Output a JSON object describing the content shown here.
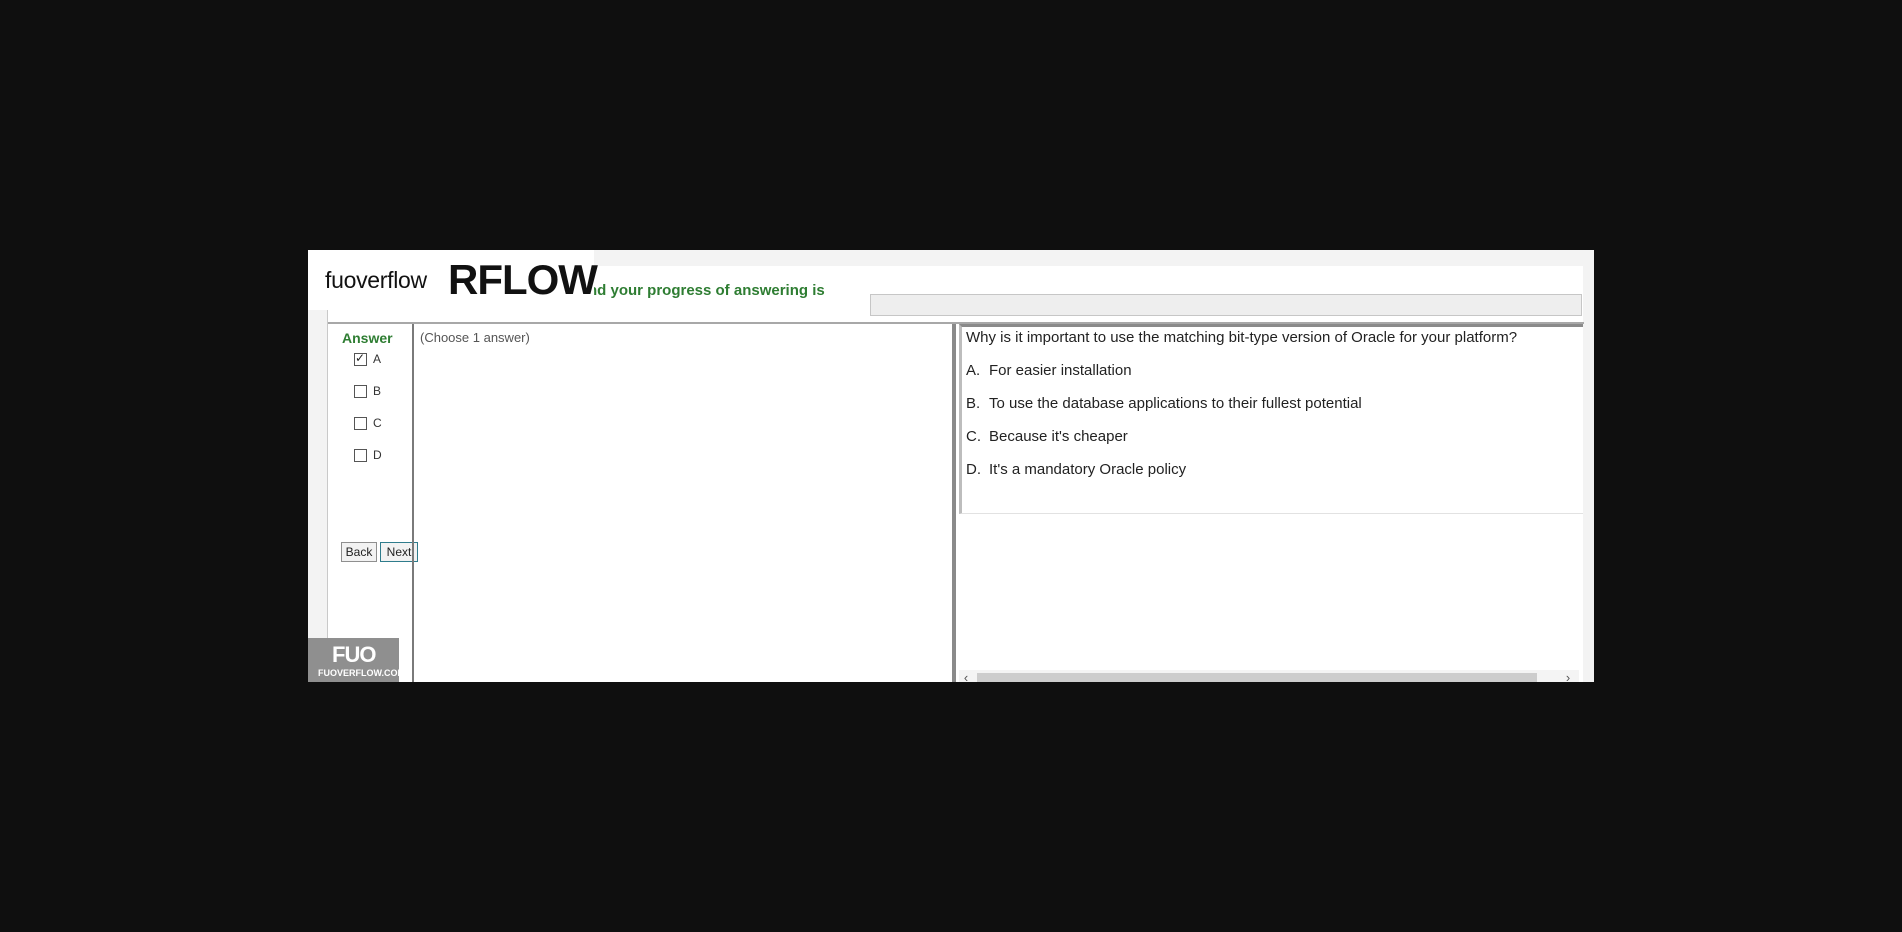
{
  "header": {
    "progress_label": "nd your progress of answering is",
    "progress_value": 0
  },
  "answer": {
    "title": "Answer",
    "options": [
      {
        "label": "A",
        "checked": true
      },
      {
        "label": "B",
        "checked": false
      },
      {
        "label": "C",
        "checked": false
      },
      {
        "label": "D",
        "checked": false
      }
    ]
  },
  "nav": {
    "back_label": "Back",
    "next_label": "Next"
  },
  "instructions": "(Choose 1 answer)",
  "question": {
    "text": "Why is it important to use the matching bit-type version of Oracle for your platform?",
    "choices": [
      {
        "letter": "A.",
        "text": "For easier installation"
      },
      {
        "letter": "B.",
        "text": "To use the database applications to their fullest potential"
      },
      {
        "letter": "C.",
        "text": "Because it's cheaper"
      },
      {
        "letter": "D.",
        "text": "It's a mandatory Oracle policy"
      }
    ]
  },
  "watermark": {
    "text": "fuoverflow",
    "big": "RFLOW",
    "badge_mark": "FUO",
    "badge_text": "FUOVERFLOW.COM"
  }
}
